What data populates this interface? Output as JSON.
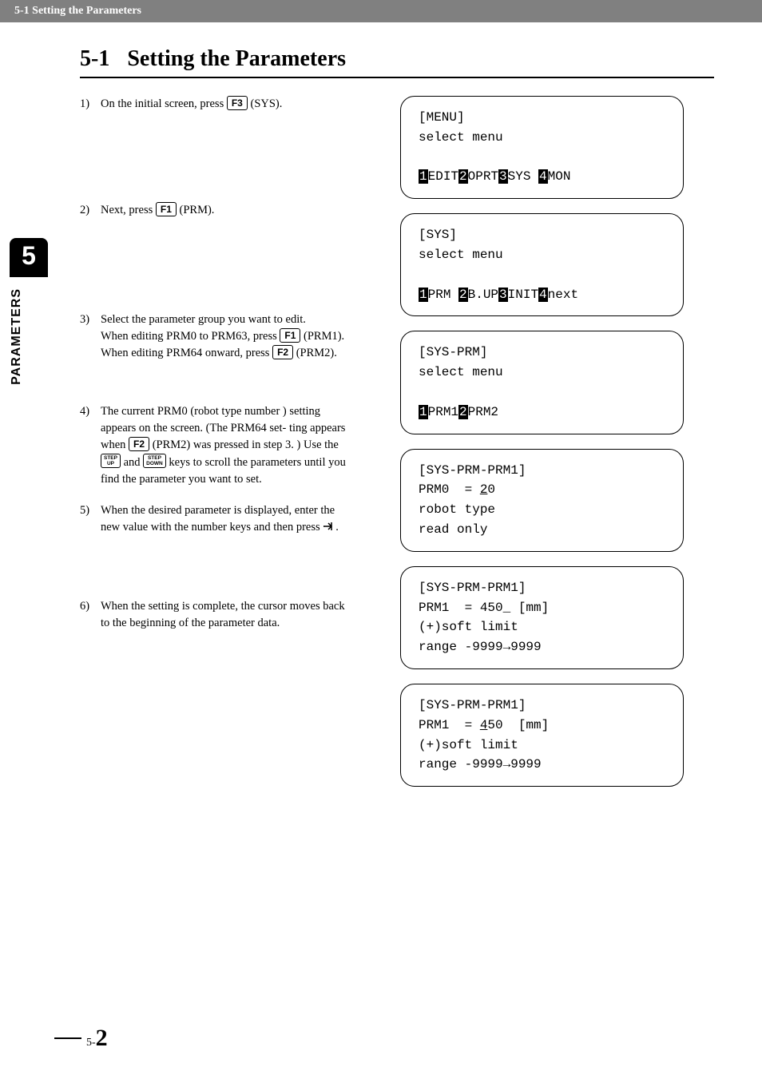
{
  "header": "5-1 Setting the Parameters",
  "sidebar": {
    "chapter_num": "5",
    "chapter_label": "PARAMETERS"
  },
  "title": {
    "number": "5-1",
    "text": "Setting the Parameters"
  },
  "steps": [
    {
      "n": "1)",
      "pre": "On the initial screen, press ",
      "k1": "F3",
      "post": " (SYS)."
    },
    {
      "n": "2)",
      "pre": "Next, press ",
      "k1": "F1",
      "post": " (PRM)."
    },
    {
      "n": "3)",
      "l1a": "Select the parameter group you want to edit.",
      "l2a": "When editing PRM0 to PRM63, press ",
      "k1": "F1",
      "l2b": " (PRM1).",
      "l3a": "When editing PRM64 onward, press ",
      "k2": "F2",
      "l3b": " (PRM2)."
    },
    {
      "n": "4)",
      "l1": "The current PRM0 (robot type number ) setting appears on the screen. (The PRM64 set-",
      "l2a": "ting appears when ",
      "k1": "F2",
      "l2b": " (PRM2) was pressed",
      "l3a": "in step 3. ) Use the ",
      "su": "STEP\nUP",
      "l3b": " and ",
      "sd": "STEP\nDOWN",
      "l3c": " keys to scroll the parameters until you find the parameter you want to set."
    },
    {
      "n": "5)",
      "l1": "When the desired parameter is displayed, enter the new value with the number keys and then press ",
      "arrow": true,
      "l2": "."
    },
    {
      "n": "6)",
      "l1": "When the setting is complete, the cursor moves back to the beginning of the parameter data."
    }
  ],
  "screens": [
    {
      "title": "[MENU]",
      "l1": "select menu",
      "fk": [
        {
          "h": "1",
          "t": "EDIT"
        },
        {
          "h": "2",
          "t": "OPRT"
        },
        {
          "h": "3",
          "t": "SYS "
        },
        {
          "h": "4",
          "t": "MON"
        }
      ]
    },
    {
      "title": "[SYS]",
      "l1": "select menu",
      "fk": [
        {
          "h": "1",
          "t": "PRM "
        },
        {
          "h": "2",
          "t": "B.UP"
        },
        {
          "h": "3",
          "t": "INIT"
        },
        {
          "h": "4",
          "t": "next"
        }
      ]
    },
    {
      "title": "[SYS-PRM]",
      "l1": "select menu",
      "fk": [
        {
          "h": "1",
          "t": "PRM1"
        },
        {
          "h": "2",
          "t": "PRM2"
        }
      ]
    },
    {
      "title": "[SYS-PRM-PRM1]",
      "l1a": "PRM0  = ",
      "u": "2",
      "l1b": "0",
      "l2": "robot type",
      "l3": "read only"
    },
    {
      "title": "[SYS-PRM-PRM1]",
      "l1": "PRM1  = 450_ [mm]",
      "l2": "(+)soft limit",
      "l3": "range -9999→9999"
    },
    {
      "title": "[SYS-PRM-PRM1]",
      "l1a": "PRM1  = ",
      "u": "4",
      "l1b": "50  [mm]",
      "l2": "(+)soft limit",
      "l3": "range -9999→9999"
    }
  ],
  "page": {
    "prefix": "5-",
    "num": "2"
  }
}
